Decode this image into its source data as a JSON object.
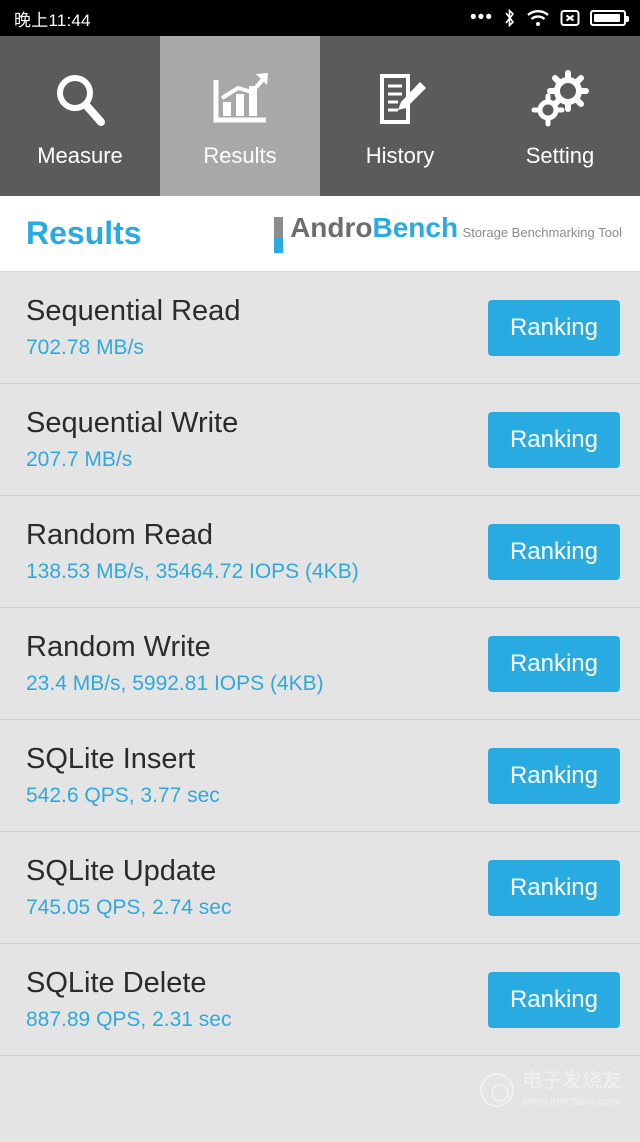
{
  "statusbar": {
    "clock": "晚上11:44",
    "icons": [
      "more-dots-icon",
      "bluetooth-icon",
      "wifi-icon",
      "x-signal-icon",
      "battery-icon"
    ]
  },
  "navbar": {
    "items": [
      {
        "label": "Measure",
        "icon": "magnifier-icon",
        "active": false
      },
      {
        "label": "Results",
        "icon": "bar-chart-icon",
        "active": true
      },
      {
        "label": "History",
        "icon": "document-pen-icon",
        "active": false
      },
      {
        "label": "Setting",
        "icon": "gears-icon",
        "active": false
      }
    ]
  },
  "titlebar": {
    "page_title": "Results",
    "brand_name_1": "Andro",
    "brand_name_2": "Bench",
    "brand_sub": "Storage Benchmarking Tool"
  },
  "results": {
    "button_label": "Ranking",
    "rows": [
      {
        "title": "Sequential Read",
        "value": "702.78 MB/s"
      },
      {
        "title": "Sequential Write",
        "value": "207.7 MB/s"
      },
      {
        "title": "Random Read",
        "value": "138.53 MB/s, 35464.72 IOPS (4KB)"
      },
      {
        "title": "Random Write",
        "value": "23.4 MB/s, 5992.81 IOPS (4KB)"
      },
      {
        "title": "SQLite Insert",
        "value": "542.6 QPS, 3.77 sec"
      },
      {
        "title": "SQLite Update",
        "value": "745.05 QPS, 2.74 sec"
      },
      {
        "title": "SQLite Delete",
        "value": "887.89 QPS, 2.31 sec"
      }
    ]
  },
  "watermark": {
    "main": "电子发烧友",
    "sub": "www.elecfans.com"
  },
  "colors": {
    "accent": "#29abe2",
    "nav_inactive": "#5b5b5b",
    "nav_active": "#a8a8a8",
    "list_bg": "#e4e4e4"
  }
}
